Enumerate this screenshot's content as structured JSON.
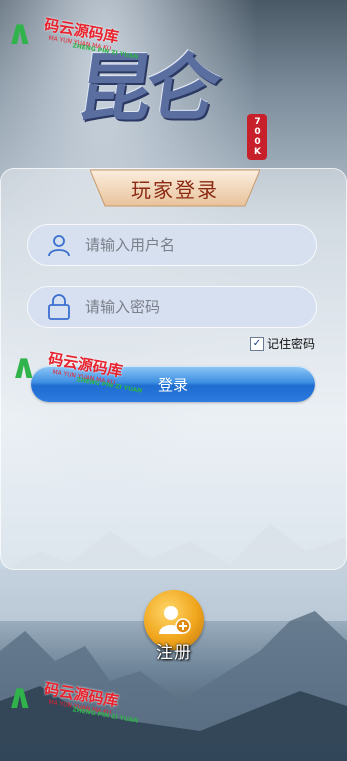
{
  "logo": {
    "text": "昆仑",
    "seal": "700K"
  },
  "login_panel": {
    "title": "玩家登录",
    "username": {
      "value": "",
      "placeholder": "请输入用户名",
      "icon": "user-icon"
    },
    "password": {
      "value": "",
      "placeholder": "请输入密码",
      "icon": "lock-icon"
    },
    "remember": {
      "label": "记住密码",
      "checked": true
    },
    "login_button": "登录"
  },
  "register": {
    "label": "注册",
    "icon": "add-user-icon"
  },
  "watermark": {
    "main": "码云源码库",
    "url": "MA YUN YUAN MA KU",
    "sub": "ZHENG PIN ZI YUAN"
  },
  "colors": {
    "title_text": "#8b2a12",
    "button_blue": "#2d7be0",
    "register_gold": "#f0a51c",
    "seal_red": "#c8202a"
  }
}
